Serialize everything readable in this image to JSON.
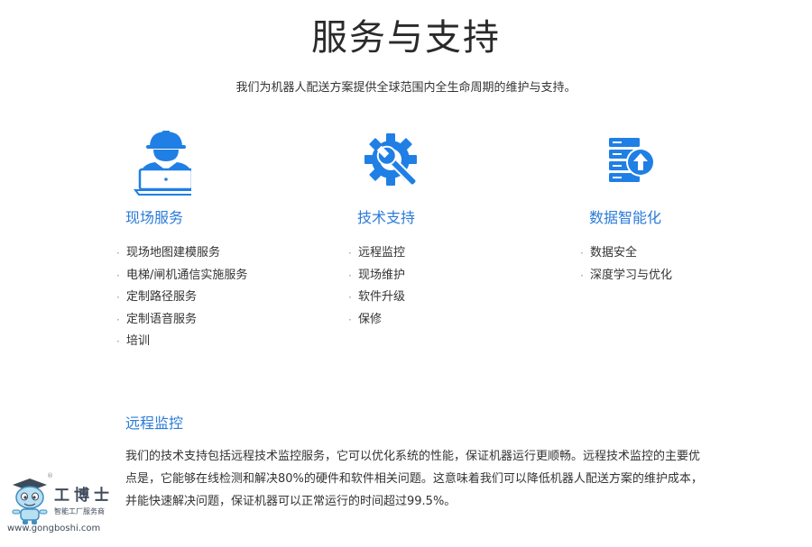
{
  "page": {
    "title": "服务与支持",
    "subtitle": "我们为机器人配送方案提供全球范围内全生命周期的维护与支持。"
  },
  "services": [
    {
      "icon": "field-engineer-laptop-icon",
      "heading": "现场服务",
      "items": [
        "现场地图建模服务",
        "电梯/闸机通信实施服务",
        "定制路径服务",
        "定制语音服务",
        "培训"
      ]
    },
    {
      "icon": "gear-wrench-icon",
      "heading": "技术支持",
      "items": [
        "远程监控",
        "现场维护",
        "软件升级",
        "保修"
      ]
    },
    {
      "icon": "server-upload-icon",
      "heading": "数据智能化",
      "items": [
        "数据安全",
        "深度学习与优化"
      ]
    }
  ],
  "bullet": "·",
  "detail": {
    "heading": "远程监控",
    "text": "我们的技术支持包括远程技术监控服务，它可以优化系统的性能，保证机器运行更顺畅。远程技术监控的主要优点是，它能够在线检测和解决80%的硬件和软件相关问题。这意味着我们可以降低机器人配送方案的维护成本，并能快速解决问题，保证机器可以正常运行的时间超过99.5%。"
  },
  "watermark": {
    "mascot_icon": "robot-mascot-icon",
    "name": "工博士",
    "registered": "®",
    "slogan": "智能工厂服务商",
    "url": "www.gongboshi.com"
  },
  "colors": {
    "accent": "#2b7bd8",
    "icon_blue": "#1f7fe5",
    "text": "#333333",
    "title": "#2a2a2a",
    "bullet": "#999999"
  }
}
